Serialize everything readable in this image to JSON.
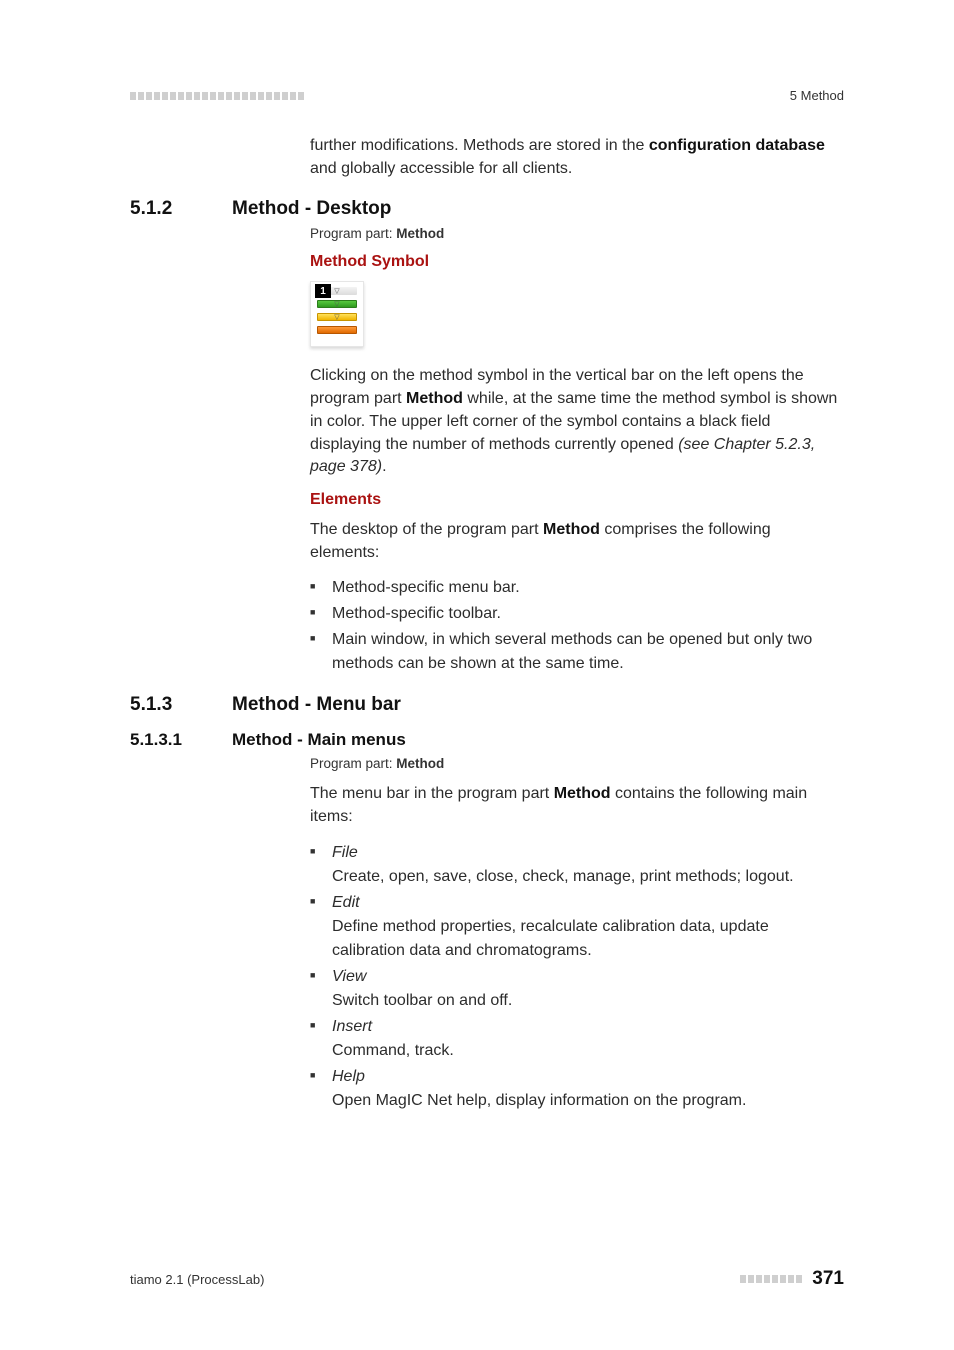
{
  "header": {
    "chapter_label": "5 Method"
  },
  "intro": {
    "para1_pre": "further modifications. Methods are stored in the ",
    "para1_bold": "configuration database",
    "para1_post": " and globally accessible for all clients."
  },
  "sec512": {
    "num": "5.1.2",
    "title": "Method - Desktop",
    "program_part_label": "Program part: ",
    "program_part_value": "Method",
    "symbol_heading": "Method Symbol",
    "badge": "1",
    "para_pre": "Clicking on the method symbol in the vertical bar on the left opens the program part ",
    "para_bold": "Method",
    "para_mid": " while, at the same time the method symbol is shown in color. The upper left corner of the symbol contains a black field displaying the number of methods currently opened ",
    "para_ref": "(see Chapter 5.2.3, page 378)",
    "para_end": ".",
    "elements_heading": "Elements",
    "elements_para_pre": "The desktop of the program part ",
    "elements_para_bold": "Method",
    "elements_para_post": " comprises the following elements:",
    "bullets": [
      "Method-specific menu bar.",
      "Method-specific toolbar.",
      "Main window, in which several methods can be opened but only two methods can be shown at the same time."
    ]
  },
  "sec513": {
    "num": "5.1.3",
    "title": "Method - Menu bar",
    "sub_num": "5.1.3.1",
    "sub_title": "Method - Main menus",
    "program_part_label": "Program part: ",
    "program_part_value": "Method",
    "para_pre": "The menu bar in the program part ",
    "para_bold": "Method",
    "para_post": " contains the following main items:",
    "menus": [
      {
        "name": "File",
        "desc": "Create, open, save, close, check, manage, print methods; logout."
      },
      {
        "name": "Edit",
        "desc": "Define method properties, recalculate calibration data, update calibration data and chromatograms."
      },
      {
        "name": "View",
        "desc": "Switch toolbar on and off."
      },
      {
        "name": "Insert",
        "desc": "Command, track."
      },
      {
        "name": "Help",
        "desc": "Open MagIC Net help, display information on the program."
      }
    ]
  },
  "footer": {
    "left": "tiamo 2.1 (ProcessLab)",
    "page": "371"
  }
}
